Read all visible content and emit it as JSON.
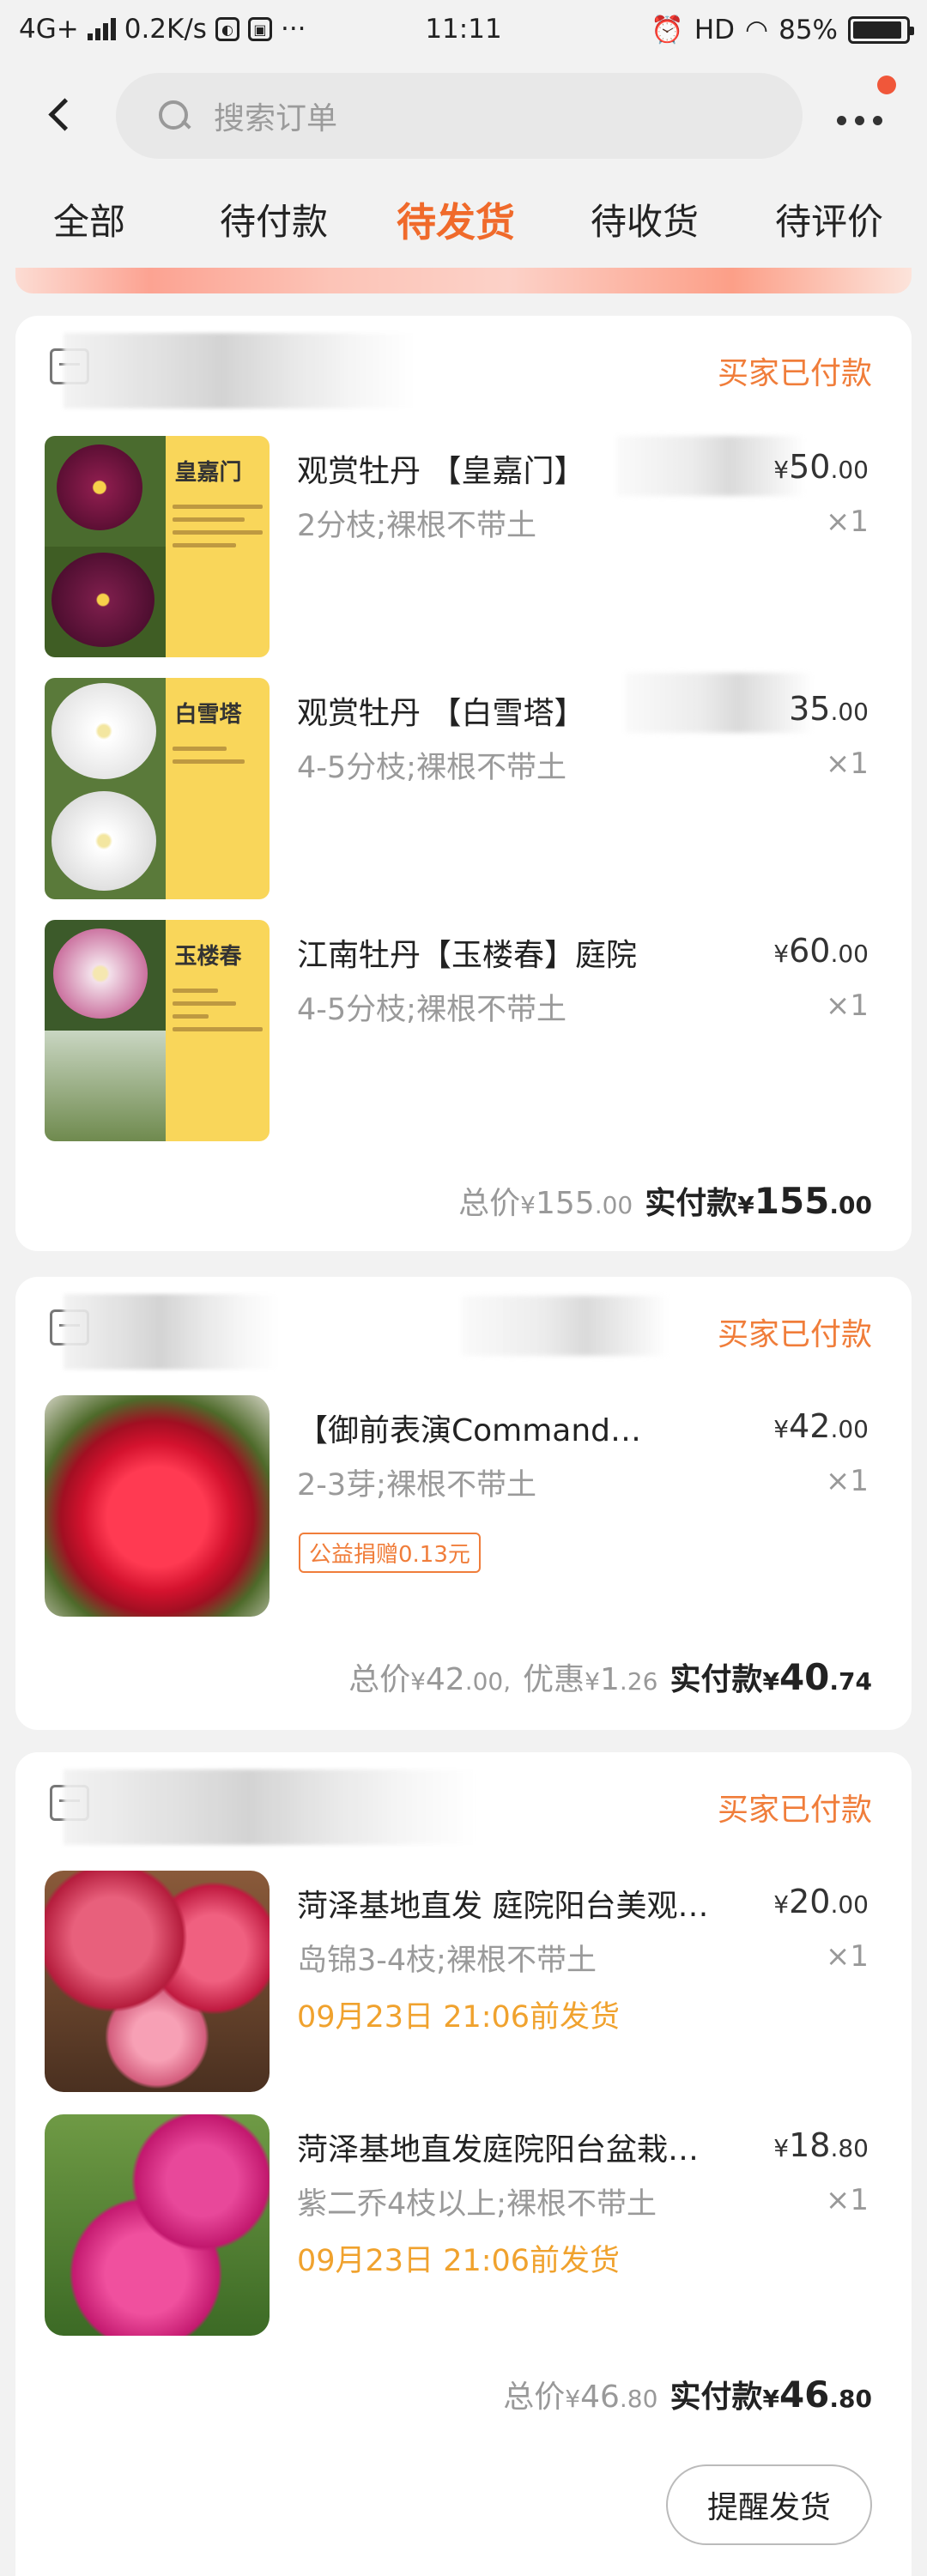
{
  "status_bar": {
    "network": "4G+",
    "speed": "0.2K/s",
    "time": "11:11",
    "hd": "HD",
    "battery": "85%"
  },
  "header": {
    "search_placeholder": "搜索订单"
  },
  "tabs": [
    {
      "label": "全部",
      "active": false
    },
    {
      "label": "待付款",
      "active": false
    },
    {
      "label": "待发货",
      "active": true
    },
    {
      "label": "待收货",
      "active": false
    },
    {
      "label": "待评价",
      "active": false
    }
  ],
  "orders": [
    {
      "status": "买家已付款",
      "items": [
        {
          "title": "观赏牡丹 【皇嘉门】",
          "spec": "2分枝;裸根不带土",
          "price_currency": "¥",
          "price_int": "50",
          "price_dec": ".00",
          "qty": "×1",
          "image_label": "皇嘉门",
          "image_color": "#7a1d4a"
        },
        {
          "title": "观赏牡丹 【白雪塔】",
          "spec": "4-5分枝;裸根不带土",
          "price_currency": "",
          "price_int": "35",
          "price_dec": ".00",
          "qty": "×1",
          "image_label": "白雪塔",
          "image_color": "#f0f0f0"
        },
        {
          "title": "江南牡丹【玉楼春】庭院",
          "spec": "4-5分枝;裸根不带土",
          "price_currency": "¥",
          "price_int": "60",
          "price_dec": ".00",
          "qty": "×1",
          "image_label": "玉楼春",
          "image_color": "#e8d6e0"
        }
      ],
      "total_label": "总价",
      "total_currency": "¥",
      "total_int": "155",
      "total_dec": ".00",
      "paid_label": "实付款",
      "paid_currency": "¥",
      "paid_int": "155",
      "paid_dec": ".00"
    },
    {
      "status": "买家已付款",
      "items": [
        {
          "title": "【御前表演Command…",
          "spec": "2-3芽;裸根不带土",
          "price_currency": "¥",
          "price_int": "42",
          "price_dec": ".00",
          "qty": "×1",
          "tag": "公益捐赠0.13元",
          "image_color": "#e0213f"
        }
      ],
      "total_label": "总价",
      "total_currency": "¥",
      "total_int": "42",
      "total_dec": ".00,",
      "discount_label": "优惠",
      "discount_currency": "¥",
      "discount_int": "1",
      "discount_dec": ".26",
      "paid_label": "实付款",
      "paid_currency": "¥",
      "paid_int": "40",
      "paid_dec": ".74"
    },
    {
      "status": "买家已付款",
      "items": [
        {
          "title": "菏泽基地直发 庭院阳台美观…",
          "spec": "岛锦3-4枝;裸根不带土",
          "price_currency": "¥",
          "price_int": "20",
          "price_dec": ".00",
          "qty": "×1",
          "ship_by": "09月23日 21:06前发货",
          "image_color": "#c8284a"
        },
        {
          "title": "菏泽基地直发庭院阳台盆栽…",
          "spec": "紫二乔4枝以上;裸根不带土",
          "price_currency": "¥",
          "price_int": "18",
          "price_dec": ".80",
          "qty": "×1",
          "ship_by": "09月23日 21:06前发货",
          "image_color": "#d6217a"
        }
      ],
      "total_label": "总价",
      "total_currency": "¥",
      "total_int": "46",
      "total_dec": ".80",
      "paid_label": "实付款",
      "paid_currency": "¥",
      "paid_int": "46",
      "paid_dec": ".80",
      "remind_button": "提醒发货"
    }
  ],
  "colors": {
    "accent": "#f06a2b",
    "status_orange": "#f07d3a",
    "ship_yellow": "#f0a22e",
    "background": "#f2f2f2"
  }
}
